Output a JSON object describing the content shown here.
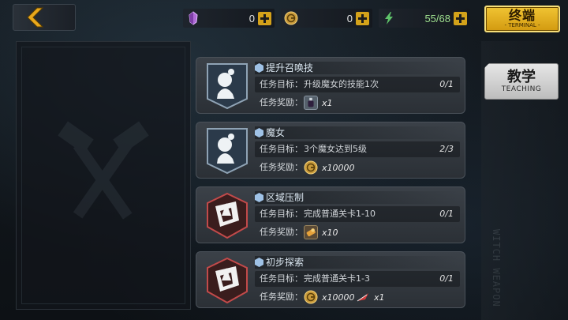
{
  "resources": [
    {
      "name": "crystal",
      "icon": "crystal-icon",
      "value": "0",
      "color": "#b06cd8"
    },
    {
      "name": "gold",
      "icon": "gold-coin-icon",
      "value": "0",
      "color": "#c99a3a"
    },
    {
      "name": "energy",
      "icon": "lightning-icon",
      "value": "55/68",
      "color": "#5fc46a"
    }
  ],
  "terminal": {
    "zh": "终端",
    "en": "- TERMINAL -"
  },
  "teaching": {
    "zh": "教学",
    "en": "TEACHING"
  },
  "watermark": "WITCH WEAPON",
  "labels": {
    "goal": "任务目标：",
    "reward": "任务奖励："
  },
  "tasks": [
    {
      "title": "提升召唤技",
      "badge": "witch-silhouette-icon",
      "goal": "升级魔女的技能1次",
      "progress": "0/1",
      "rewards": [
        {
          "icon": "potion-item-icon",
          "qty": "x1"
        }
      ]
    },
    {
      "title": "魔女",
      "badge": "witch-silhouette-icon",
      "goal": "3个魔女达到5级",
      "progress": "2/3",
      "rewards": [
        {
          "icon": "gold-coin-icon",
          "qty": "x10000"
        }
      ]
    },
    {
      "title": "区域压制",
      "badge": "stage-emblem-icon",
      "goal": "完成普通关卡1-10",
      "progress": "0/1",
      "rewards": [
        {
          "icon": "scroll-item-icon",
          "qty": "x10"
        }
      ]
    },
    {
      "title": "初步探索",
      "badge": "stage-emblem-icon",
      "goal": "完成普通关卡1-3",
      "progress": "0/1",
      "rewards": [
        {
          "icon": "gold-coin-icon",
          "qty": "x10000"
        },
        {
          "icon": "red-feather-icon",
          "qty": "x1"
        }
      ]
    }
  ]
}
